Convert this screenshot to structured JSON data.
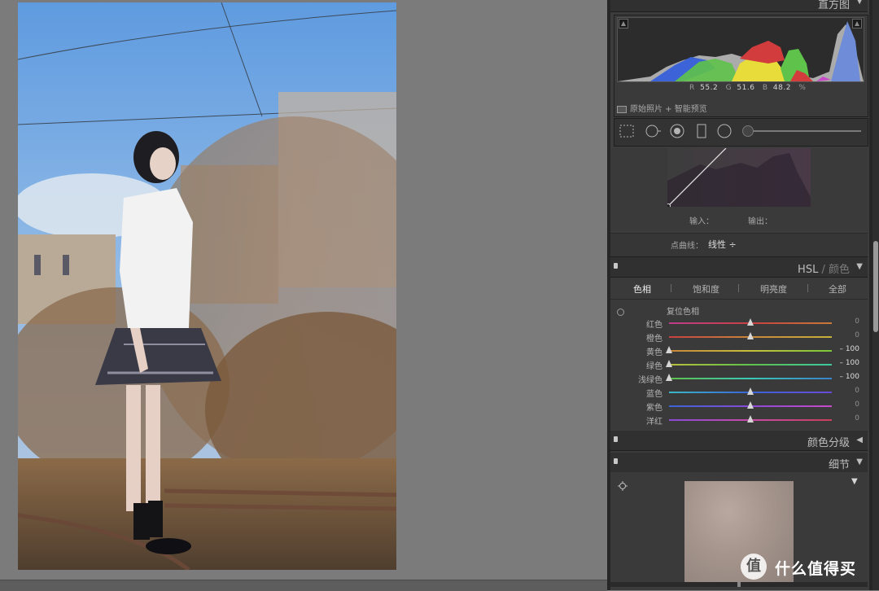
{
  "photo": {
    "description_alt": ""
  },
  "panels": {
    "histogram": {
      "title": "直方图"
    },
    "hsl": {
      "title_main": "HSL",
      "title_sep": " / ",
      "title_alt": "颜色"
    },
    "split_toning": {
      "title": "颜色分级"
    },
    "detail": {
      "title": "细节"
    }
  },
  "histogram": {
    "r_label": "R",
    "r_value": "55.2",
    "g_label": "G",
    "g_value": "51.6",
    "b_label": "B",
    "b_value": "48.2",
    "unit": "%",
    "preview_status": "原始照片 + 智能预览"
  },
  "curve": {
    "input_label": "输入：",
    "output_label": "输出：",
    "mode_label": "点曲线：",
    "mode_value": "线性 ÷"
  },
  "hsl": {
    "tabs": [
      "色相",
      "饱和度",
      "明亮度",
      "全部"
    ],
    "active_tab": "色相",
    "reset_label": "复位色相",
    "rows": [
      {
        "label": "红色",
        "value": "0",
        "position": 0.5
      },
      {
        "label": "橙色",
        "value": "0",
        "position": 0.5
      },
      {
        "label": "黄色",
        "value": "– 100",
        "position": 0.0
      },
      {
        "label": "绿色",
        "value": "– 100",
        "position": 0.0
      },
      {
        "label": "浅绿色",
        "value": "– 100",
        "position": 0.0
      },
      {
        "label": "蓝色",
        "value": "0",
        "position": 0.5
      },
      {
        "label": "紫色",
        "value": "0",
        "position": 0.5
      },
      {
        "label": "洋红",
        "value": "0",
        "position": 0.5
      }
    ]
  },
  "watermark": {
    "icon": "值",
    "text": "什么值得买"
  },
  "colors": {
    "panel_bg": "#3c3c3c",
    "canvas_bg": "#7b7b7b",
    "hist_red": "#d33c3c",
    "hist_green": "#5fc24a",
    "hist_blue": "#3c64d8",
    "hist_yellow": "#e8dc3a"
  }
}
